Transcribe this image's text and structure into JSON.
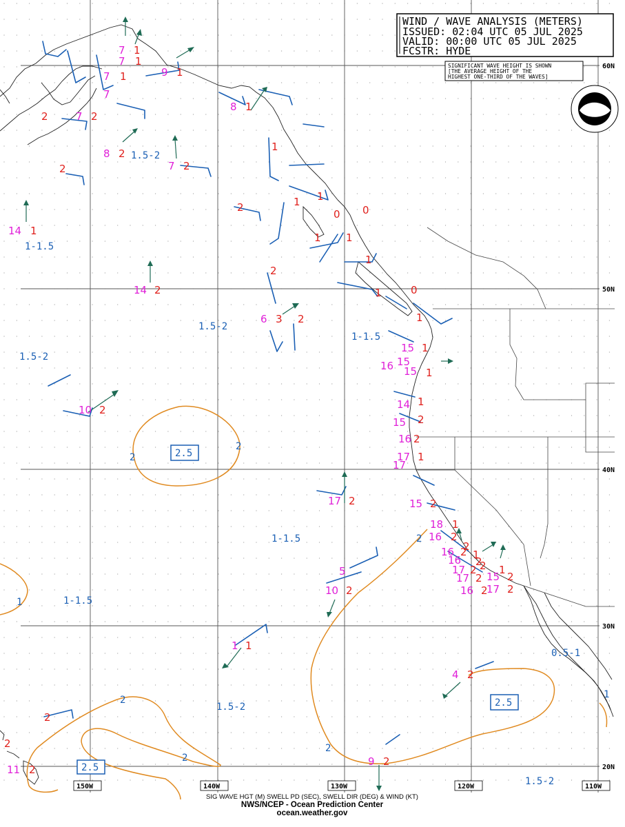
{
  "header": {
    "line1": "WIND / WAVE ANALYSIS (METERS)",
    "line2": "ISSUED: 02:04 UTC 05 JUL 2025",
    "line3": "VALID:  00:00 UTC 05 JUL 2025",
    "line4": "FCSTR:  HYDE"
  },
  "note": {
    "line1": "SIGNIFICANT WAVE HEIGHT IS SHOWN",
    "line2": "[THE AVERAGE HEIGHT OF THE",
    "line3": "HIGHEST ONE-THIRD OF THE WAVES]"
  },
  "latitudes": [
    "60N",
    "50N",
    "40N",
    "30N",
    "20N"
  ],
  "longitudes": [
    "150W",
    "140W",
    "130W",
    "120W",
    "110W"
  ],
  "footer": {
    "legend": "SIG WAVE HGT (M) SWELL PD (SEC), SWELL DIR (DEG) & WIND (KT)",
    "org": "NWS/NCEP - Ocean Prediction Center",
    "site": "ocean.weather.gov"
  },
  "region_labels": [
    "1-1.5",
    "1.5-2",
    "1.5-2",
    "1.5-2",
    "1-1.5",
    "1-1.5",
    "1-1.5",
    "1.5-2",
    "0.5-1",
    "1.5-2"
  ],
  "boxed_labels": [
    "2.5",
    "2.5",
    "2.5"
  ],
  "contour_labels": [
    "2",
    "2",
    "2",
    "2",
    "2",
    "2",
    "1",
    "1"
  ],
  "wave_heights": [
    "1",
    "1",
    "1",
    "2",
    "1",
    "2",
    "2",
    "2",
    "2",
    "1",
    "1",
    "0",
    "0",
    "1",
    "1",
    "2",
    "0",
    "1",
    "2",
    "3",
    "2",
    "1",
    "1",
    "2",
    "1",
    "1",
    "1",
    "1",
    "1",
    "1",
    "2",
    "2",
    "1",
    "2",
    "2",
    "1",
    "2",
    "2",
    "2",
    "2",
    "2",
    "1",
    "2",
    "2",
    "2",
    "2",
    "2",
    "2",
    "2",
    "2",
    "1",
    "2",
    "2",
    "1",
    "2",
    "2"
  ],
  "swell_periods": [
    "7",
    "7",
    "7",
    "9",
    "8",
    "7",
    "8",
    "7",
    "14",
    "14",
    "6",
    "10",
    "15",
    "15",
    "16",
    "15",
    "14",
    "15",
    "16",
    "17",
    "17",
    "17",
    "15",
    "18",
    "16",
    "16",
    "16",
    "17",
    "17",
    "16",
    "15",
    "17",
    "5",
    "10",
    "1",
    "4",
    "9",
    "11",
    "7"
  ],
  "noaa_logo": "NOAA"
}
